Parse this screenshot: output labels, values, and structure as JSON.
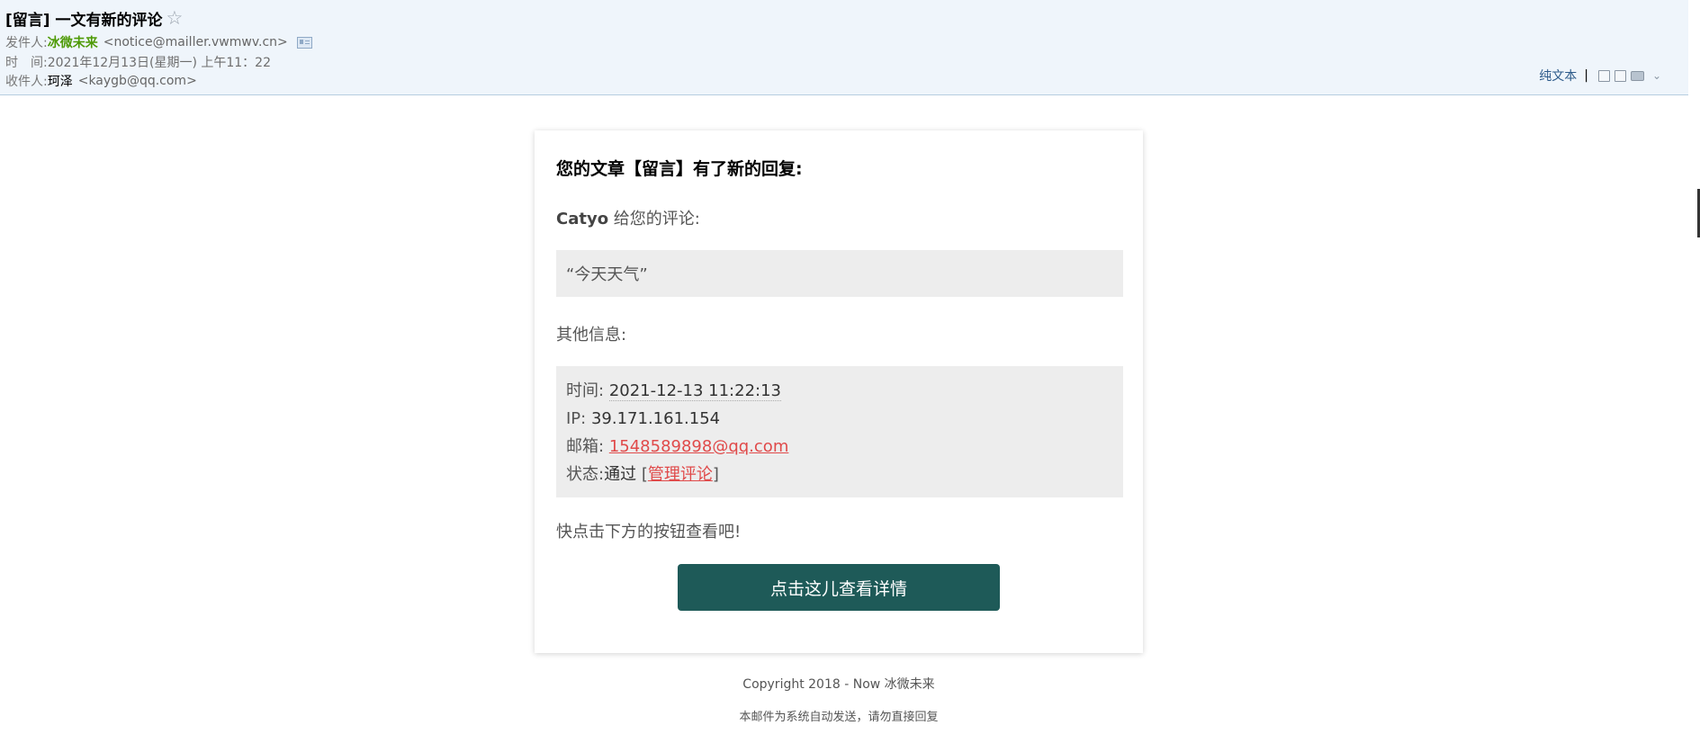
{
  "header": {
    "subject": "[留言] 一文有新的评论",
    "star_icon": "☆",
    "from_label": "发件人:",
    "from_name": "冰微未来",
    "from_addr": "<notice@mailler.vwmwv.cn>",
    "time_label": "时　间:",
    "time_value": "2021年12月13日(星期一) 上午11：22",
    "to_label": "收件人:",
    "to_name": "珂泽",
    "to_addr": "<kaygb@qq.com>",
    "plain_text": "纯文本",
    "separator": "|",
    "more_icon": "⌄"
  },
  "card": {
    "title": "您的文章【留言】有了新的回复:",
    "commenter": "Catyo",
    "commenter_suffix": " 给您的评论:",
    "quote": "“今天天气”",
    "other_title": "其他信息:",
    "time_label": "时间:",
    "time_value": "2021-12-13 11:22:13",
    "ip_label": "IP:",
    "ip_value": "39.171.161.154",
    "email_label": "邮箱:",
    "email_value": "1548589898@qq.com",
    "status_label": "状态:",
    "status_value": "通过 ",
    "status_bracket_open": "[",
    "manage_link": "管理评论",
    "status_bracket_close": "]",
    "hint": "快点击下方的按钮查看吧!",
    "button": "点击这儿查看详情"
  },
  "footer": {
    "copyright": "Copyright 2018 - Now 冰微未来",
    "notice": "本邮件为系统自动发送，请勿直接回复"
  },
  "colors": {
    "header_bg": "#eff5fb",
    "sender_green": "#4e9a06",
    "button_bg": "#1e5a58",
    "link_red": "#e04a4a",
    "box_bg": "#ededed"
  }
}
